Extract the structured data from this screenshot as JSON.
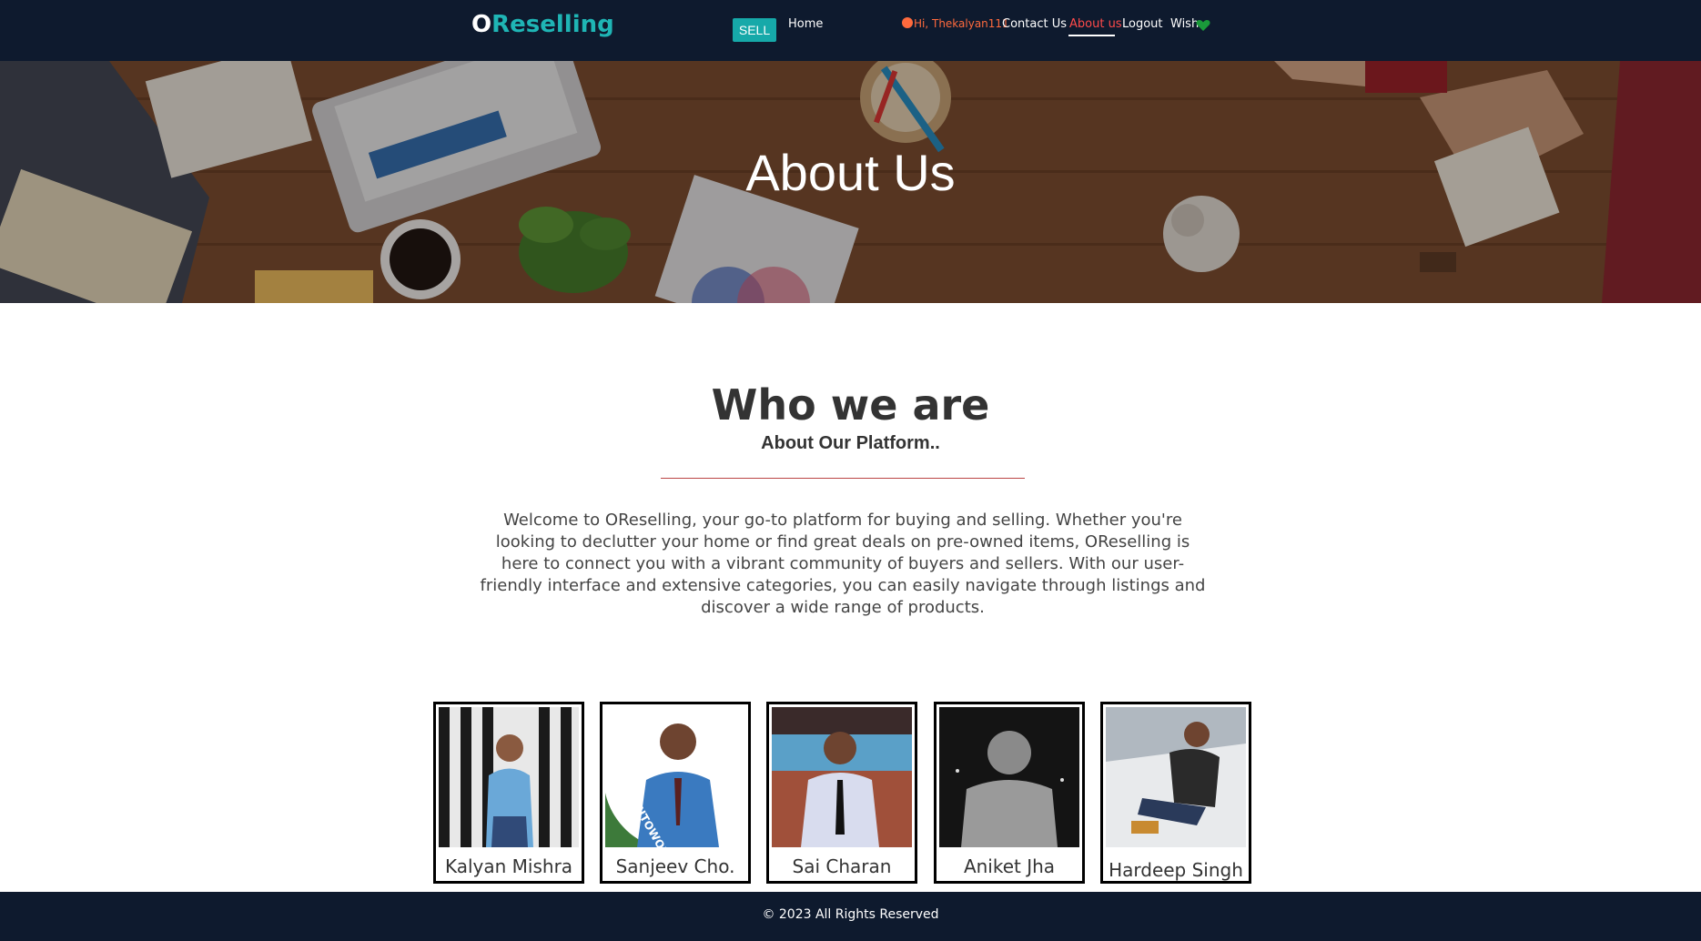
{
  "nav": {
    "logo_o": "O",
    "logo_rest": "Reselling",
    "sell": "SELL",
    "home": "Home",
    "user_greeting": "Hi, Thekalyan111",
    "contact": "Contact Us",
    "about": "About us",
    "logout": "Logout",
    "wish": "Wish"
  },
  "hero": {
    "title": "About Us"
  },
  "who": {
    "title": "Who we are",
    "subtitle": "About Our Platform..",
    "paragraph": "Welcome to OReselling, your go-to platform for buying and selling. Whether you're looking to declutter your home or find great deals on pre-owned items, OReselling is here to connect you with a vibrant community of buyers and sellers. With our user-friendly interface and extensive categories, you can easily navigate through listings and discover a wide range of products."
  },
  "team": [
    {
      "name": "Kalyan Mishra"
    },
    {
      "name": "Sanjeev Cho."
    },
    {
      "name": "Sai Charan"
    },
    {
      "name": "Aniket Jha"
    },
    {
      "name": "Hardeep Singh"
    }
  ],
  "footer": {
    "text": "© 2023 All Rights Reserved"
  },
  "colors": {
    "nav_bg": "#0e1a2e",
    "accent": "#16a9a9",
    "active_link": "#ff4a4a",
    "wish_heart": "#1a9a3a"
  }
}
